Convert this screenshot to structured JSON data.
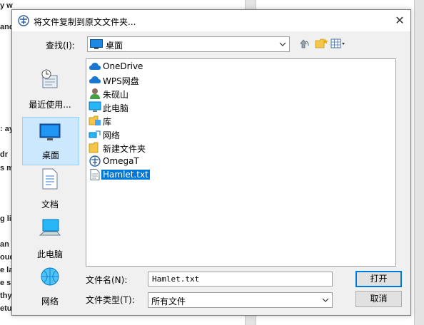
{
  "background": {
    "lines": [
      "y w",
      "and",
      ": ay",
      "dr",
      "s m",
      "g lit",
      "an",
      "oud",
      "e la",
      "e s",
      "thy",
      "etu"
    ]
  },
  "dialog": {
    "title": "将文件复制到原文文件夹...",
    "close_label": "✕",
    "look_in_label": "查找(I):",
    "look_in_value": "桌面",
    "toolbar": {
      "up_icon": "up-folder-icon",
      "new_folder_icon": "new-folder-icon",
      "view_icon": "view-menu-icon"
    },
    "places": [
      {
        "label": "最近使用...",
        "icon": "recent-icon"
      },
      {
        "label": "桌面",
        "icon": "desktop-icon"
      },
      {
        "label": "文档",
        "icon": "documents-icon"
      },
      {
        "label": "此电脑",
        "icon": "computer-icon"
      },
      {
        "label": "网络",
        "icon": "network-icon"
      }
    ],
    "files": [
      {
        "label": "OneDrive",
        "icon": "cloud-icon"
      },
      {
        "label": "WPS网盘",
        "icon": "cloud-icon"
      },
      {
        "label": "朱砚山",
        "icon": "user-icon"
      },
      {
        "label": "此电脑",
        "icon": "computer-icon"
      },
      {
        "label": "库",
        "icon": "library-icon"
      },
      {
        "label": "网络",
        "icon": "network-icon"
      },
      {
        "label": "新建文件夹",
        "icon": "folder-icon"
      },
      {
        "label": "OmegaT",
        "icon": "omegat-icon"
      },
      {
        "label": "Hamlet.txt",
        "icon": "text-file-icon",
        "selected": true
      }
    ],
    "file_name_label": "文件名(N):",
    "file_name_value": "Hamlet.txt",
    "file_type_label": "文件类型(T):",
    "file_type_value": "所有文件",
    "open_label": "打开",
    "cancel_label": "取消",
    "accent_color": "#0078d7"
  }
}
